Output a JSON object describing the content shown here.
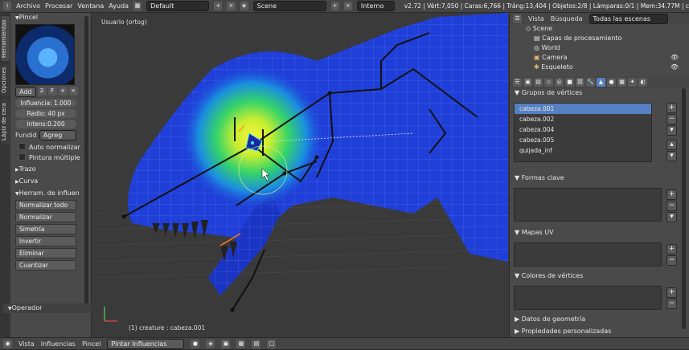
{
  "topbar": {
    "menus": [
      "Archivo",
      "Procesar",
      "Ventana",
      "Ayuda"
    ],
    "layout": "Default",
    "scene": "Scene",
    "engine": "Interno",
    "stats": "v2.72 | Vért:7,050 | Caras:6,766 | Tráng:13,404 | Objetos:2/8 | Lámparas:0/1 | Mem:34.77M | c"
  },
  "left_tabs": [
    "Herramientas",
    "Opciones",
    "Lápiz de cera"
  ],
  "tool_panel": {
    "header": "Pincel",
    "add_label": "Add",
    "brush_users": "2",
    "brush_fake": "F",
    "influence": "Influencia: 1.000",
    "radius": "Radio: 40 px",
    "strength": "Intens:0.200",
    "blend_label": "Fundid",
    "blend_value": "Agreg",
    "auto_normalize": "Auto normalizar",
    "multi_paint": "Pintura múltiple",
    "stroke": "Trazo",
    "curve": "Curva",
    "tools_header": "Herram. de influen",
    "tools": [
      "Normalizar todo",
      "Normalizar",
      "Simetría",
      "Invertir",
      "Eliminar",
      "Cuantizar"
    ],
    "operator": "Operador"
  },
  "viewport": {
    "view_label": "Usuario (ortog)",
    "object_label": "(1) creature : cabeza.001"
  },
  "outliner": {
    "tabs": [
      "Vista",
      "Búsqueda"
    ],
    "filter": "Todas las escenas",
    "items": [
      "Scene",
      "Capas de procesamiento",
      "World",
      "Camera",
      "Esqueleto"
    ]
  },
  "properties": {
    "vertex_groups_header": "Grupos de vértices",
    "vertex_groups": [
      "cabeza.001",
      "cabeza.002",
      "cabeza.004",
      "cabeza.005",
      "quijada_inf"
    ],
    "shape_keys": "Formas clave",
    "uv_maps": "Mapas UV",
    "vertex_colors": "Colores de vértices",
    "geometry_data": "Datos de geometría",
    "custom_props": "Propiedades personalizadas"
  },
  "bottombar": {
    "items": [
      "Vista",
      "Influencias",
      "Pincel"
    ],
    "mode": "Pintar Influencias"
  },
  "colors": {
    "selection": "#5680c2",
    "mesh_blue": "#1f3fd8",
    "heat_green": "#2fd36a",
    "heat_yellow": "#e8f03a"
  }
}
